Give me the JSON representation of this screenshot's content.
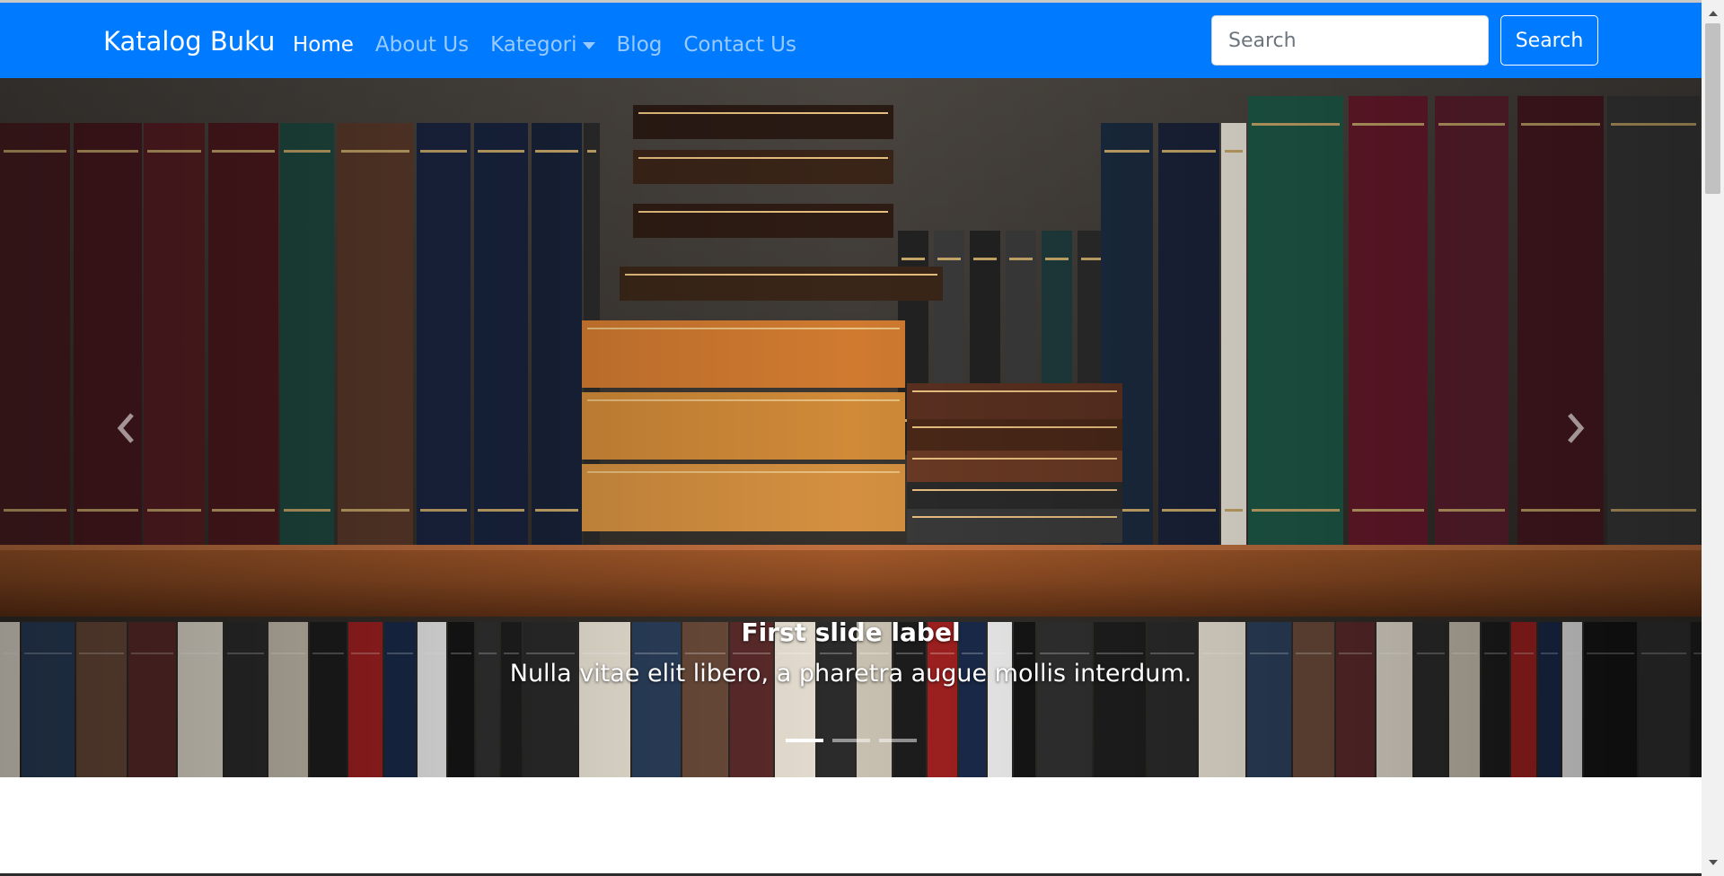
{
  "navbar": {
    "brand": "Katalog Buku",
    "links": [
      {
        "label": "Home",
        "active": true
      },
      {
        "label": "About Us"
      },
      {
        "label": "Kategori",
        "dropdown": true
      },
      {
        "label": "Blog"
      },
      {
        "label": "Contact Us"
      }
    ],
    "search": {
      "placeholder": "Search",
      "value": ""
    },
    "search_button": "Search"
  },
  "carousel": {
    "caption_title": "First slide label",
    "caption_text": "Nulla vitae elit libero, a pharetra augue mollis interdum.",
    "indicators": 3,
    "active_indicator": 0,
    "prev_icon": "chevron-left-icon",
    "next_icon": "chevron-right-icon"
  },
  "colors": {
    "navbar_bg": "#007bff",
    "shelf": "#8a4a22"
  }
}
